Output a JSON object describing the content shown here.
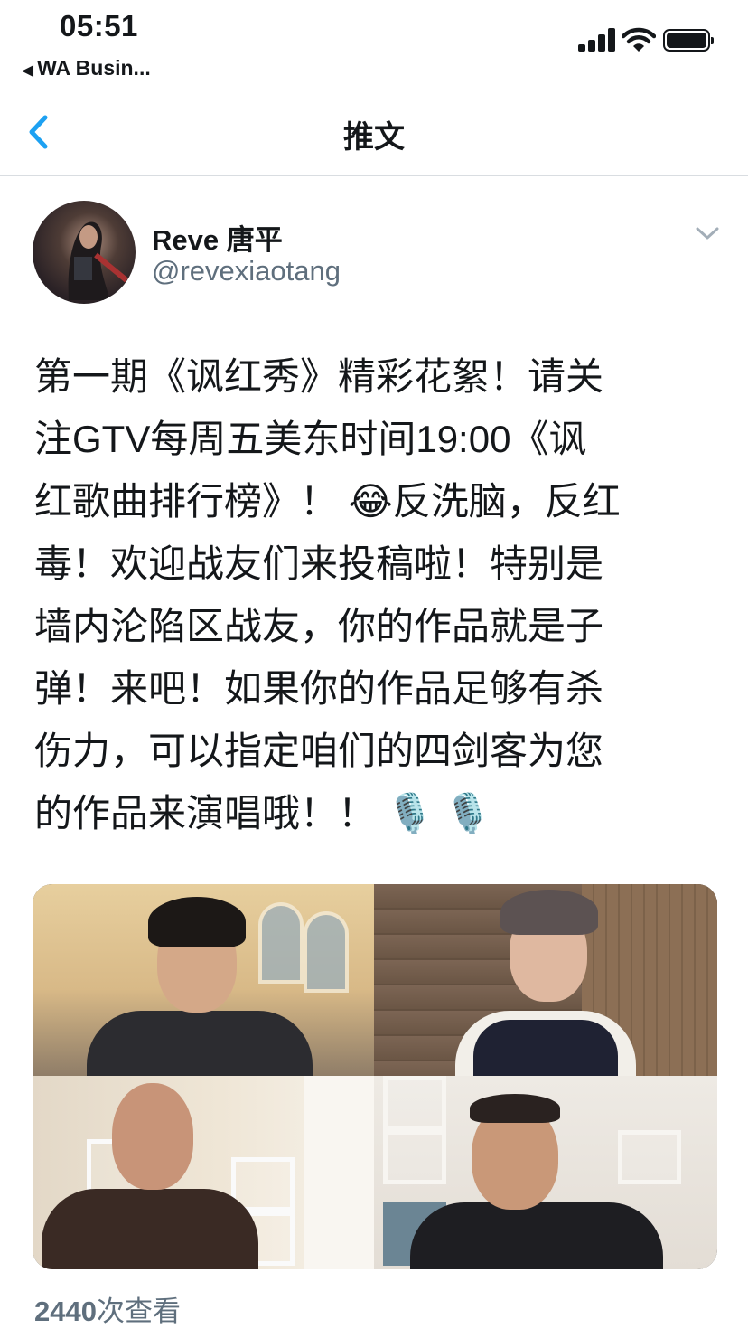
{
  "status_bar": {
    "time": "05:51",
    "back_app": "WA Busin...",
    "back_glyph": "◀"
  },
  "nav": {
    "title": "推文",
    "back_icon": "chevron-left-icon",
    "accent": "#1da1f2"
  },
  "tweet": {
    "author": {
      "name_latin": "Reve",
      "name_cjk": "唐平",
      "handle": "@revexiaotang"
    },
    "text_lines": [
      "第一期《讽红秀》精彩花絮！请关",
      "注GTV每周五美东时间19:00《讽",
      "红歌曲排行榜》！ 😂反洗脑，反红",
      "毒！欢迎战友们来投稿啦！特别是",
      "墙内沦陷区战友，你的作品就是子",
      "弹！来吧！如果你的作品足够有杀",
      "伤力，可以指定咱们的四剑客为您",
      "的作品来演唱哦！！ 🎙️ 🎙️"
    ],
    "views": {
      "count": "2440",
      "label": "次查看"
    }
  },
  "colors": {
    "text": "#14171a",
    "secondary": "#5f6f7d",
    "divider": "#d9dde1"
  }
}
